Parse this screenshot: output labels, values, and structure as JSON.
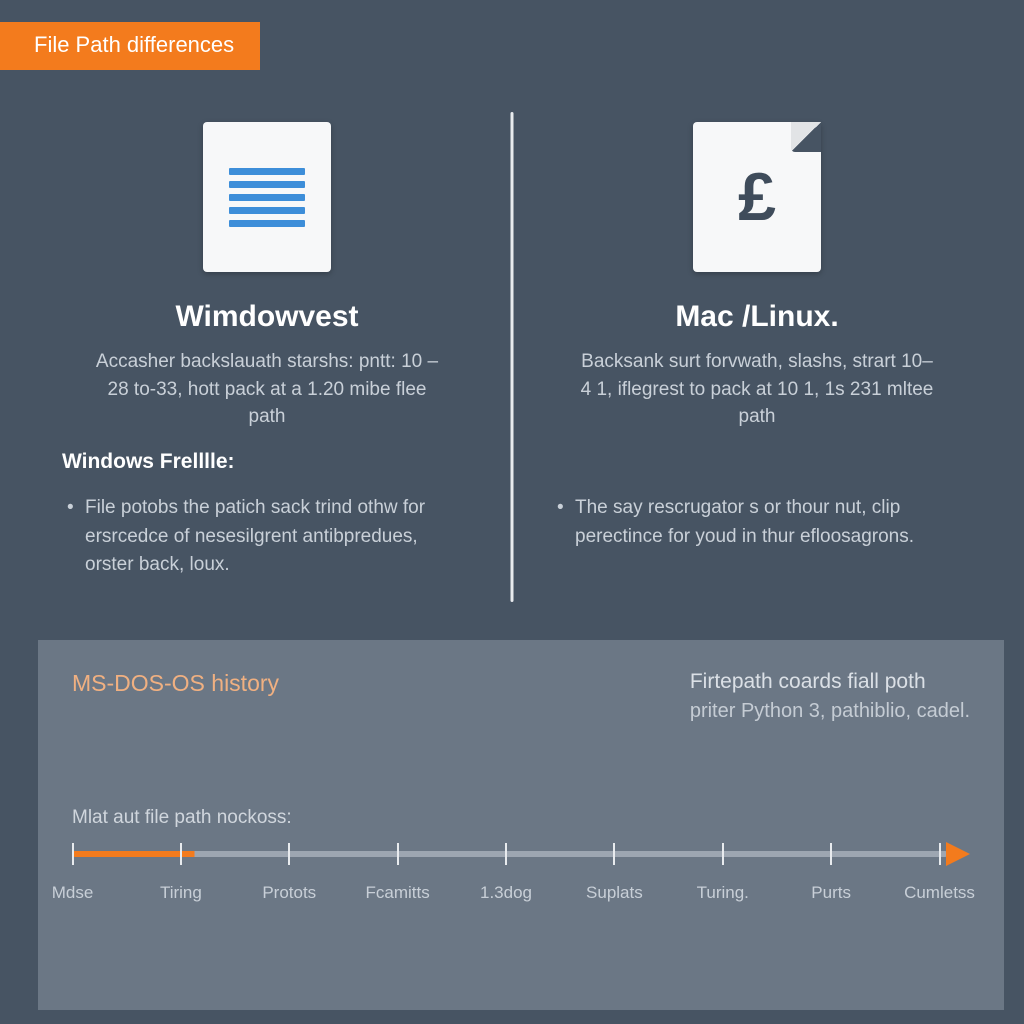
{
  "title": "File Path differences",
  "left": {
    "heading": "Wimdowvest",
    "desc": "Accasher backslauath starshs: pntt: 10 – 28 to-33, hott pack at a 1.20 mibe flee path",
    "subhead": "Windows Frelllle:",
    "bullet": "File potobs the patich sack trind othw for ersrcedce of nesesilgrent antibpredues, orster back, loux."
  },
  "right": {
    "heading": "Mac /Linux.",
    "desc": "Backsank surt forvwath, slashs, strart 10–4 1, iflegrest to pack at 10 1, 1s 231 mltee path",
    "bullet": "The say rescrugator s or thour nut, clip perectince for youd in thur efloosagrons."
  },
  "history": {
    "title": "MS-DOS-OS history",
    "right_line1": "Firtepath coards fiall poth",
    "right_line2": "priter Python 3, pathiblio, cadel.",
    "caption": "Mlat aut file path nockoss:",
    "ticks": [
      "Mdse",
      "Tiring",
      "Protots",
      "Fcamitts",
      "1.3dog",
      "Suplats",
      "Turing.",
      "Purts",
      "Cumletss"
    ]
  },
  "colors": {
    "accent": "#f37b1d",
    "bg": "#475463"
  }
}
